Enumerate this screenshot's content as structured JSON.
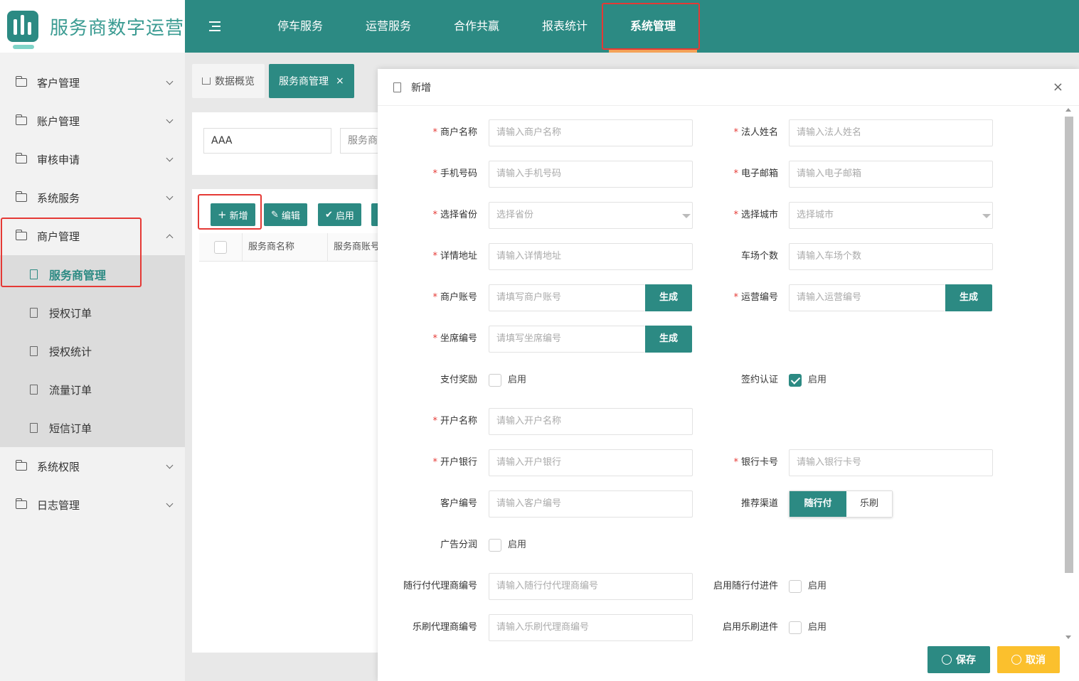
{
  "app": {
    "title": "服务商数字运营"
  },
  "topnav": {
    "items": [
      "停车服务",
      "运营服务",
      "合作共赢",
      "报表统计",
      "系统管理"
    ],
    "active": "系统管理"
  },
  "sidebar": {
    "items_top": [
      "客户管理",
      "账户管理",
      "审核申请",
      "系统服务"
    ],
    "open_group": "商户管理",
    "sub_items": [
      "服务商管理",
      "授权订单",
      "授权统计",
      "流量订单",
      "短信订单"
    ],
    "items_bottom": [
      "系统权限",
      "日志管理"
    ]
  },
  "tabs": [
    {
      "label": "数据概览"
    },
    {
      "label": "服务商管理",
      "close": "×"
    }
  ],
  "filter": {
    "value1": "AAA",
    "value2": "服务商"
  },
  "toolbar": {
    "add": "新增",
    "edit": "编辑",
    "enable": "启用"
  },
  "table": {
    "headers": [
      "服务商名称",
      "服务商账号"
    ]
  },
  "modal": {
    "title": "新增",
    "close": "×",
    "fields": {
      "merchant_name": {
        "label": "商户名称",
        "placeholder": "请输入商户名称"
      },
      "legal_name": {
        "label": "法人姓名",
        "placeholder": "请输入法人姓名"
      },
      "phone": {
        "label": "手机号码",
        "placeholder": "请输入手机号码"
      },
      "email": {
        "label": "电子邮箱",
        "placeholder": "请输入电子邮箱"
      },
      "province": {
        "label": "选择省份",
        "placeholder": "选择省份"
      },
      "city": {
        "label": "选择城市",
        "placeholder": "选择城市"
      },
      "address": {
        "label": "详情地址",
        "placeholder": "请输入详情地址"
      },
      "lot_count": {
        "label": "车场个数",
        "placeholder": "请输入车场个数"
      },
      "merchant_account": {
        "label": "商户账号",
        "placeholder": "请填写商户账号",
        "button": "生成"
      },
      "ops_no": {
        "label": "运营编号",
        "placeholder": "请输入运营编号",
        "button": "生成"
      },
      "seat_no": {
        "label": "坐席编号",
        "placeholder": "请填写坐席编号",
        "button": "生成"
      },
      "pay_reward": {
        "label": "支付奖励",
        "option": "启用",
        "checked": false
      },
      "sign_auth": {
        "label": "签约认证",
        "option": "启用",
        "checked": true
      },
      "account_name": {
        "label": "开户名称",
        "placeholder": "请输入开户名称"
      },
      "bank": {
        "label": "开户银行",
        "placeholder": "请输入开户银行"
      },
      "card_no": {
        "label": "银行卡号",
        "placeholder": "请输入银行卡号"
      },
      "customer_no": {
        "label": "客户编号",
        "placeholder": "请输入客户编号"
      },
      "channel": {
        "label": "推荐渠道",
        "options": [
          "随行付",
          "乐刷"
        ],
        "selected": "随行付"
      },
      "ad_share": {
        "label": "广告分润",
        "option": "启用",
        "checked": false
      },
      "sxf_agent": {
        "label": "随行付代理商编号",
        "placeholder": "请输入随行付代理商编号"
      },
      "sxf_enable": {
        "label": "启用随行付进件",
        "option": "启用",
        "checked": false
      },
      "ls_agent": {
        "label": "乐刷代理商编号",
        "placeholder": "请输入乐刷代理商编号"
      },
      "ls_enable": {
        "label": "启用乐刷进件",
        "option": "启用",
        "checked": false
      }
    },
    "footer": {
      "save": "保存",
      "cancel": "取消"
    }
  },
  "colors": {
    "primary": "#2c8a83",
    "warning": "#fbc02d",
    "highlight": "#e53935"
  }
}
